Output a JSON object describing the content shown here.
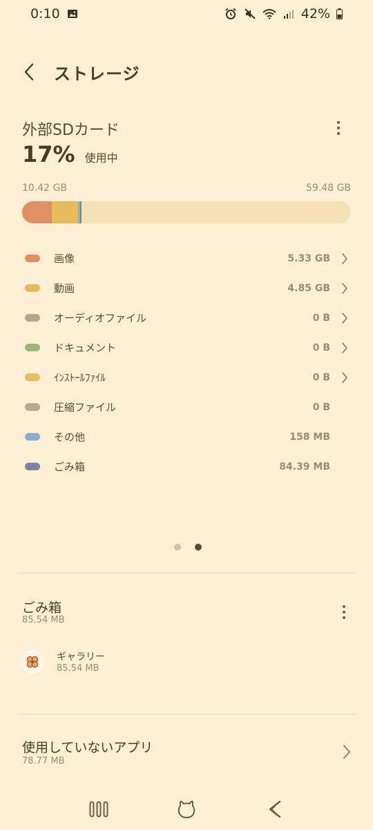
{
  "status_bar": {
    "time": "0:10",
    "battery": "42%"
  },
  "header": {
    "title": "ストレージ"
  },
  "storage": {
    "name": "外部SDカード",
    "percent": "17%",
    "in_use_label": "使用中",
    "used": "10.42 GB",
    "total": "59.48 GB"
  },
  "categories": [
    {
      "label": "画像",
      "size": "5.33 GB",
      "color": "#e08f64",
      "fraction": 0.0896,
      "chevron": true
    },
    {
      "label": "動画",
      "size": "4.85 GB",
      "color": "#e8bb5c",
      "fraction": 0.0815,
      "chevron": true
    },
    {
      "label": "オーディオファイル",
      "size": "0 B",
      "color": "#b8a88a",
      "fraction": 0,
      "chevron": true
    },
    {
      "label": "ドキュメント",
      "size": "0 B",
      "color": "#9ab872",
      "fraction": 0,
      "chevron": true
    },
    {
      "label": "ｲﾝｽﾄｰﾙﾌｧｲﾙ",
      "size": "0 B",
      "color": "#e8bb5c",
      "fraction": 0,
      "chevron": true
    },
    {
      "label": "圧縮ファイル",
      "size": "0 B",
      "color": "#b8a88a",
      "fraction": 0,
      "chevron": false
    },
    {
      "label": "その他",
      "size": "158 MB",
      "color": "#8aaed0",
      "fraction": 0.0027,
      "chevron": false
    },
    {
      "label": "ごみ箱",
      "size": "84.39 MB",
      "color": "#7c83a0",
      "fraction": 0.0014,
      "chevron": false
    }
  ],
  "pager": {
    "pages": 2,
    "active": 1
  },
  "trash": {
    "title": "ごみ箱",
    "size": "85.54 MB",
    "items": [
      {
        "name": "ギャラリー",
        "size": "85.54 MB",
        "icon": "clover-icon"
      }
    ]
  },
  "unused_apps": {
    "title": "使用していないアプリ",
    "size": "78.77 MB"
  },
  "colors": {
    "background": "#fdf0d6",
    "bar_track": "#f5e1b6",
    "text_primary": "#4b3b28",
    "text_secondary": "#9a8c76"
  },
  "nav": {
    "recents_icon": "recents-icon",
    "home_icon": "home-icon",
    "back_icon": "back-icon"
  }
}
